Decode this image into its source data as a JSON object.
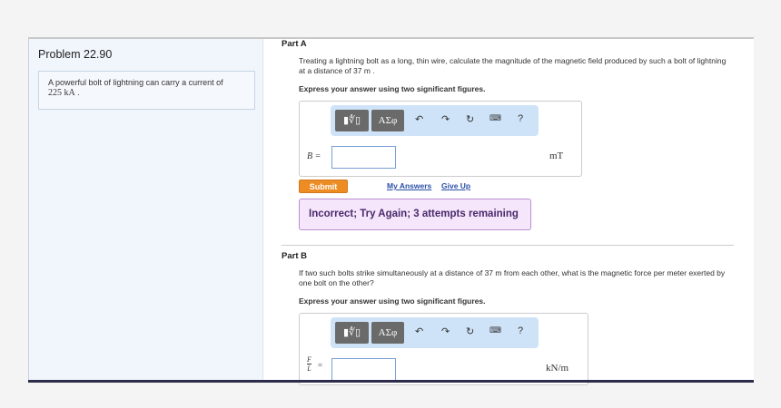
{
  "problem": {
    "title": "Problem 22.90",
    "intro_text": "A powerful bolt of lightning can carry a current of",
    "intro_value": "225 kA",
    "intro_end": "."
  },
  "toolbar": {
    "templates_label": "▮∜▯",
    "greek_label": "ΑΣφ",
    "undo_icon": "undo-icon",
    "redo_icon": "redo-icon",
    "reset_icon": "reset-icon",
    "keyboard_icon": "keyboard-icon",
    "help_label": "?"
  },
  "part_a": {
    "title": "Part A",
    "question": "Treating a lightning bolt as a long, thin wire, calculate the magnitude of the magnetic field produced by such a bolt of lightning at a distance of 37 m .",
    "instruction": "Express your answer using two significant figures.",
    "variable": "B =",
    "input_value": "",
    "unit": "mT",
    "submit": "Submit",
    "my_answers": "My Answers",
    "give_up": "Give Up",
    "feedback": "Incorrect; Try Again; 3 attempts remaining"
  },
  "part_b": {
    "title": "Part B",
    "question": "If two such bolts strike simultaneously at a distance of 37 m from each other, what is the magnetic force per meter exerted by one bolt on the other?",
    "instruction": "Express your answer using two significant figures.",
    "var_num": "F",
    "var_den": "L",
    "var_eq": "=",
    "input_value": "",
    "unit": "kN/m"
  },
  "colors": {
    "submit": "#ee8c24",
    "feedback_bg": "#f6e6fb",
    "toolbar_bg": "#cfe3f8",
    "link": "#2b4fa8"
  }
}
